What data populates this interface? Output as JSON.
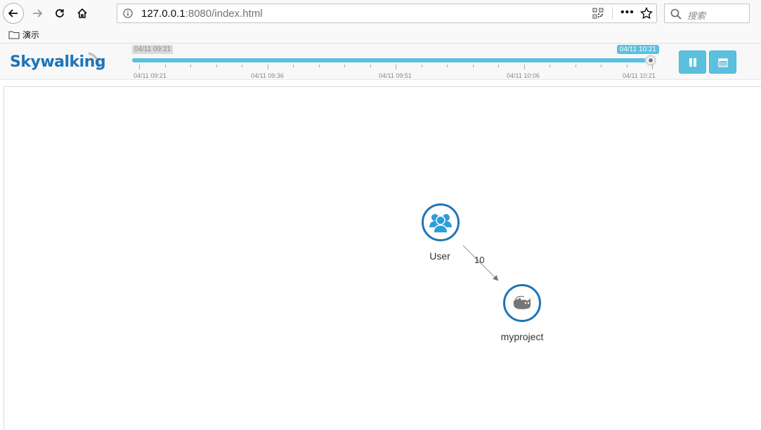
{
  "browser": {
    "url_host": "127.0.0.1",
    "url_rest": ":8080/index.html",
    "search_placeholder": "搜索",
    "bookmark_label": "演示"
  },
  "app": {
    "logo_sky": "Sky",
    "logo_walking": "walking"
  },
  "timeline": {
    "start_badge": "04/11 09:21",
    "end_badge": "04/11 10:21",
    "tick_labels": [
      "04/11 09:21",
      "04/11 09:36",
      "04/11 09:51",
      "04/11 10:06",
      "04/11 10:21"
    ],
    "slider_fraction": 1.0
  },
  "buttons": {
    "pause_icon": "pause-icon",
    "calendar_icon": "calendar-icon"
  },
  "topology": {
    "nodes": [
      {
        "label": "User",
        "icon": "users-icon"
      },
      {
        "label": "myproject",
        "icon": "tomcat-icon"
      }
    ],
    "edge_label": "10"
  },
  "colors": {
    "accent": "#5bc0de",
    "node_border": "#1f74b6",
    "user_icon": "#2d9cdb"
  }
}
